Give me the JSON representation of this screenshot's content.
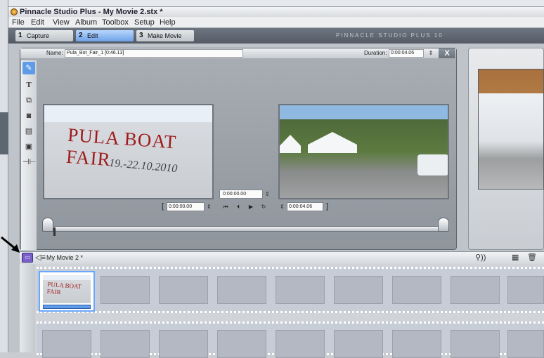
{
  "window": {
    "title": "Pinnacle Studio Plus - My Movie 2.stx *"
  },
  "menu": [
    "File",
    "Edit",
    "View",
    "Album",
    "Toolbox",
    "Setup",
    "Help"
  ],
  "tabs": [
    {
      "num": "1",
      "label": "Capture"
    },
    {
      "num": "2",
      "label": "Edit"
    },
    {
      "num": "3",
      "label": "Make Movie"
    }
  ],
  "brand": "PINNACLE STUDIO PLUS 10",
  "editor": {
    "name_label": "Name:",
    "name_value": "Pula_Bot_Fair_1 [0:46.13]",
    "duration_label": "Duration:",
    "duration_value": "0:00:04.06",
    "close": "X",
    "tools": [
      "video-tool",
      "title-tool",
      "overlay-tool",
      "camera-tool",
      "effects-tool",
      "frame-tool",
      "audio-tool"
    ]
  },
  "transport": {
    "timecode": "0:00:00.00",
    "in_value": "0:00:00.00",
    "out_value": "0:00:04.06"
  },
  "images": {
    "left_sign": "PULA BOAT FAIR",
    "left_date": "19.-22.10.2010",
    "clip_sign": "PULA BOAT FAIR"
  },
  "storyboard": {
    "title": "My Movie 2 *"
  }
}
